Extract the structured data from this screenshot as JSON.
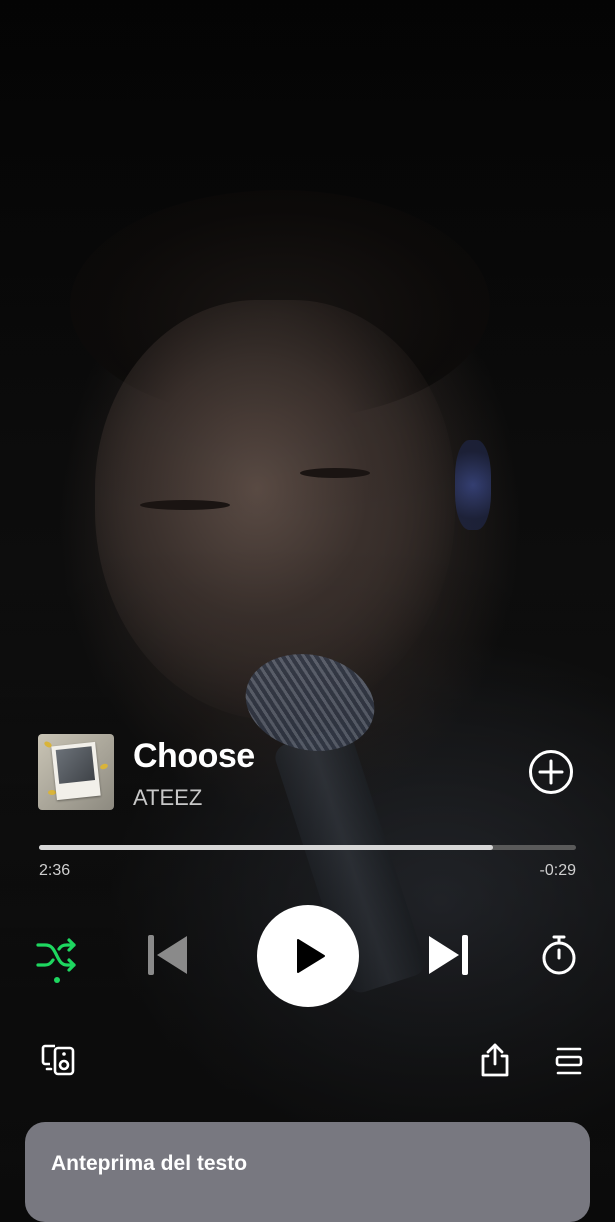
{
  "track": {
    "title": "Choose",
    "artist": "ATEEZ",
    "cover_icon": "album-cover"
  },
  "playback": {
    "elapsed": "2:36",
    "remaining": "-0:29",
    "progress_fraction": 0.845,
    "shuffle_enabled": true,
    "state": "paused"
  },
  "colors": {
    "accent": "#1ed760",
    "background": "#0a0a0a",
    "progress_fill": "#d7d7d7",
    "lyrics_card": "#787880"
  },
  "icons": {
    "add": "plus-circle-icon",
    "shuffle": "shuffle-icon",
    "previous": "skip-previous-icon",
    "play": "play-icon",
    "next": "skip-next-icon",
    "timer": "sleep-timer-icon",
    "devices": "connect-device-icon",
    "share": "share-icon",
    "queue": "queue-icon"
  },
  "lyrics_preview": {
    "title": "Anteprima del testo"
  }
}
